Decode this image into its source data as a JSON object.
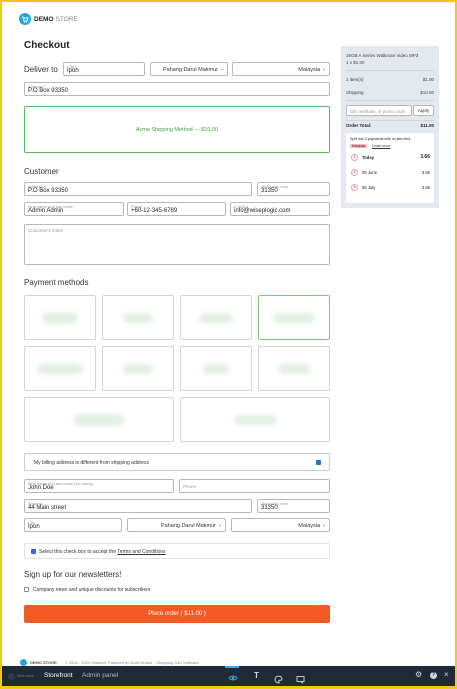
{
  "brand": {
    "name": "DEMO",
    "suffix": "STORE"
  },
  "page_title": "Checkout",
  "deliver": {
    "label": "Deliver to",
    "city_label": "City *",
    "city_value": "Ipoh",
    "state_value": "Pahang Darul Makmur",
    "country_value": "Malaysia",
    "address_label": "Address *",
    "address_value": "P.O Box 93350"
  },
  "shipping_method": "Acme Shipping Method — $10.00",
  "customer": {
    "title": "Customer",
    "address_label": "Address *",
    "address_value": "P.O Box 93350",
    "zip_label": "Zip/postal code",
    "zip_value": "31350",
    "name_label": "First name and last name",
    "name_value": "Admin Admin",
    "phone_label": "Phone",
    "phone_value": "+60-12-345-6789",
    "email_label": "E-mail *",
    "email_value": "info@wiseplogic.com",
    "notes_placeholder": "Customer's notes"
  },
  "payment": {
    "title": "Payment methods"
  },
  "billing": {
    "checkbox_label": "My billing address is different from shipping address",
    "name_label": "First name and last name (for billing)",
    "name_value": "John Doe",
    "phone_label": "Phone",
    "address_label": "Address",
    "address_value": "44 Main street",
    "zip_label": "Zip/postal code",
    "zip_value": "31350",
    "city_label": "City",
    "city_value": "Ipoh",
    "state_value": "Pahang Darul Makmur",
    "country_value": "Malaysia"
  },
  "terms": {
    "prefix": "Select this check box to accept the ",
    "link": "Terms and Conditions"
  },
  "newsletter": {
    "title": "Sign up for our newsletters!",
    "option": "Company news and unique discounts for subscribers"
  },
  "place_order": "Place order ( $11.00 )",
  "summary": {
    "product_line1": "16GB A Series Walkman Video MP3",
    "product_line2": "1 x $1.00",
    "items_label": "1 item(s)",
    "items_value": "$1.00",
    "shipping_label": "Shipping",
    "shipping_value": "$10.00",
    "gift_placeholder": "Gift certificate, or promo code",
    "apply": "Apply",
    "total_label": "Order Total:",
    "total_value": "$11.00",
    "installments": {
      "heading": "Split into 3 payments with no late fees",
      "brand": "Kompap",
      "learn": "Learn more",
      "rows": [
        {
          "num": "1",
          "label": "Today",
          "amount": "3.66"
        },
        {
          "num": "2",
          "label": "05 June",
          "amount": "3.66"
        },
        {
          "num": "3",
          "label": "05 July",
          "amount": "3.66"
        }
      ]
    }
  },
  "footer": {
    "brand": "DEMO STORE",
    "text": "© 2004 - 2024 Simtech.  Powered by Multi-Vendor - Shopping Cart Software"
  },
  "toolbar": {
    "left_label": "Storefront",
    "right_label": "Admin panel",
    "left_small": "Web tools"
  },
  "colors": {
    "accent": "#f15a22",
    "selected": "#5cb85c",
    "link": "#2d6cdf",
    "toolbar": "#1f2a35"
  }
}
